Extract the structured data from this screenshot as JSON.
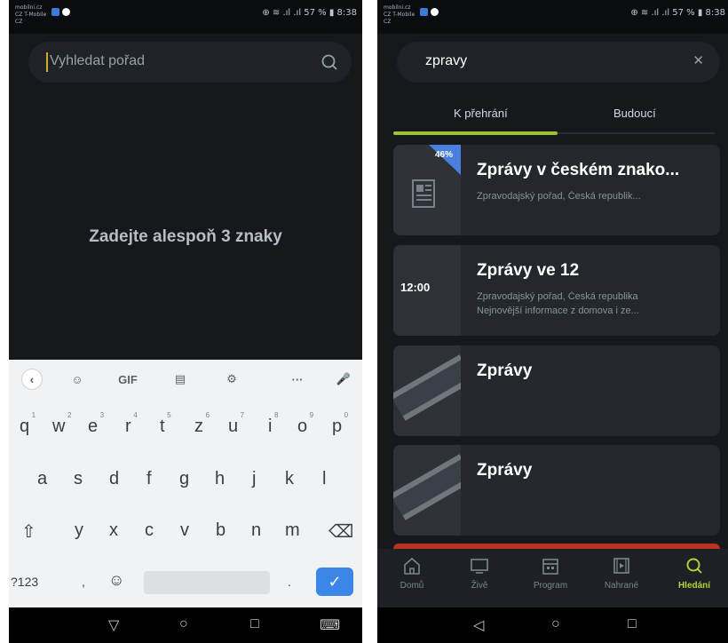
{
  "left_screen": {
    "status": {
      "carrier": "mobilni.cz CZ T-Mobile CZ",
      "right": "⊕ ≋ .ıl .ıl 57 % ▮ 8:38"
    },
    "search": {
      "placeholder": "Vyhledat pořad"
    },
    "empty_message": "Zadejte alespoň 3 znaky",
    "keyboard": {
      "toolbar": [
        "‹",
        "☺",
        "GIF",
        "▤",
        "⚙",
        "···",
        "🎤"
      ],
      "row1": [
        {
          "key": "q",
          "hint": "1"
        },
        {
          "key": "w",
          "hint": "2"
        },
        {
          "key": "e",
          "hint": "3"
        },
        {
          "key": "r",
          "hint": "4"
        },
        {
          "key": "t",
          "hint": "5"
        },
        {
          "key": "z",
          "hint": "6"
        },
        {
          "key": "u",
          "hint": "7"
        },
        {
          "key": "i",
          "hint": "8"
        },
        {
          "key": "o",
          "hint": "9"
        },
        {
          "key": "p",
          "hint": "0"
        }
      ],
      "row2": [
        "a",
        "s",
        "d",
        "f",
        "g",
        "h",
        "j",
        "k",
        "l"
      ],
      "row3": [
        "⇧",
        "y",
        "x",
        "c",
        "v",
        "b",
        "n",
        "m",
        "⌫"
      ],
      "row4": {
        "symbols": "?123",
        "comma": ",",
        "emoji": "☺",
        "period": ".",
        "enter": "✓"
      }
    },
    "navbar": [
      "▽",
      "○",
      "□",
      "⌨"
    ]
  },
  "right_screen": {
    "status": {
      "carrier": "mobilni.cz CZ T-Mobile CZ",
      "right": "⊕ ≋ .ıl .ıl 57 % ▮ 8:38"
    },
    "search": {
      "value": "zpravy",
      "clear_icon": "✕"
    },
    "tabs": [
      {
        "label": "K přehrání",
        "active": true
      },
      {
        "label": "Budoucí",
        "active": false
      }
    ],
    "results": [
      {
        "title": "Zprávy v českém znako...",
        "line1": "Zpravodajský pořad, Česká republik...",
        "line2": "",
        "badge": "46%",
        "thumb": "newspaper-icon"
      },
      {
        "title": "Zprávy ve 12",
        "line1": "Zpravodajský pořad, Česká republika",
        "line2": "Nejnovější informace z domova i ze...",
        "thumb_text": "12:00"
      },
      {
        "title": "Zprávy",
        "line1": "",
        "line2": "",
        "thumb": "film-reel"
      },
      {
        "title": "Zprávy",
        "line1": "",
        "line2": "",
        "thumb": "film-reel"
      }
    ],
    "bottom_nav": [
      {
        "label": "Domů",
        "icon": "home-icon"
      },
      {
        "label": "Živě",
        "icon": "tv-icon"
      },
      {
        "label": "Program",
        "icon": "calendar-icon"
      },
      {
        "label": "Nahrané",
        "icon": "recording-icon"
      },
      {
        "label": "Hledání",
        "icon": "search-icon",
        "active": true
      }
    ],
    "navbar": [
      "◁",
      "○",
      "□"
    ],
    "accent": "#b5d334"
  }
}
